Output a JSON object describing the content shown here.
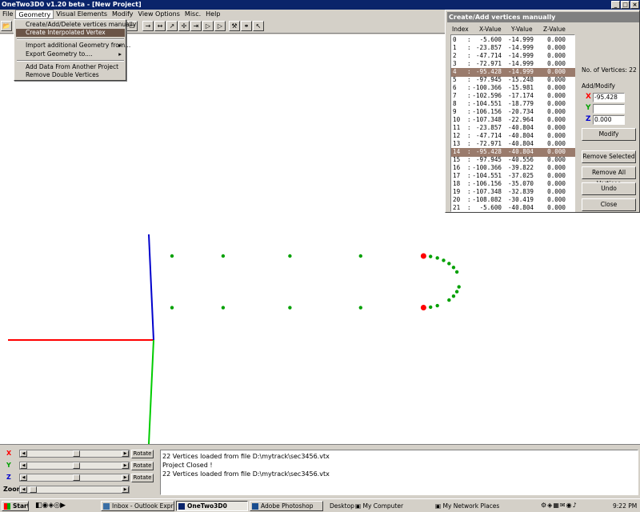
{
  "window": {
    "title": "OneTwo3D0 v1.20 beta - [New Project]",
    "controls": [
      "_",
      "□",
      "×"
    ]
  },
  "menubar": [
    "File",
    "Geometry",
    "Visual Elements",
    "Modify",
    "View Options",
    "Misc.",
    "Help"
  ],
  "geometry_menu": {
    "items": [
      {
        "label": "Create/Add/Delete vertices manually",
        "submenu": false
      },
      {
        "label": "Create Interpolated Vertex",
        "submenu": false,
        "highlighted": true
      },
      {
        "label": "Import additional Geometry from...",
        "submenu": true
      },
      {
        "label": "Export Geometry to....",
        "submenu": true
      },
      {
        "label": "Add Data From Another Project",
        "submenu": false
      },
      {
        "label": "Remove Double Vertices",
        "submenu": false
      }
    ]
  },
  "toolbar": {
    "icons": [
      "open-icon",
      "arrow-right-icon",
      "arrows-horizontal-icon",
      "arrow-diagonal-icon",
      "crosshair-icon",
      "arrow-right-line-icon",
      "arrow-right-bar-icon",
      "arrow-right-bar2-icon",
      "tools-icon",
      "binoculars-icon",
      "cursor-icon"
    ]
  },
  "dialog": {
    "title": "Create/Add vertices manually",
    "columns": [
      "Index",
      "X-Value",
      "Y-Value",
      "Z-Value"
    ],
    "vertices": [
      {
        "i": "0",
        "x": "-5.600",
        "y": "-14.999",
        "z": "0.000"
      },
      {
        "i": "1",
        "x": "-23.857",
        "y": "-14.999",
        "z": "0.000"
      },
      {
        "i": "2",
        "x": "-47.714",
        "y": "-14.999",
        "z": "0.000"
      },
      {
        "i": "3",
        "x": "-72.971",
        "y": "-14.999",
        "z": "0.000"
      },
      {
        "i": "4",
        "x": "-95.428",
        "y": "-14.999",
        "z": "0.000",
        "selected": true
      },
      {
        "i": "5",
        "x": "-97.945",
        "y": "-15.248",
        "z": "0.000"
      },
      {
        "i": "6",
        "x": "-100.366",
        "y": "-15.981",
        "z": "0.000"
      },
      {
        "i": "7",
        "x": "-102.596",
        "y": "-17.174",
        "z": "0.000"
      },
      {
        "i": "8",
        "x": "-104.551",
        "y": "-18.779",
        "z": "0.000"
      },
      {
        "i": "9",
        "x": "-106.156",
        "y": "-20.734",
        "z": "0.000"
      },
      {
        "i": "10",
        "x": "-107.348",
        "y": "-22.964",
        "z": "0.000"
      },
      {
        "i": "11",
        "x": "-23.857",
        "y": "-40.804",
        "z": "0.000"
      },
      {
        "i": "12",
        "x": "-47.714",
        "y": "-40.804",
        "z": "0.000"
      },
      {
        "i": "13",
        "x": "-72.971",
        "y": "-40.804",
        "z": "0.000"
      },
      {
        "i": "14",
        "x": "-95.428",
        "y": "-40.804",
        "z": "0.000",
        "selected": true
      },
      {
        "i": "15",
        "x": "-97.945",
        "y": "-40.556",
        "z": "0.000"
      },
      {
        "i": "16",
        "x": "-100.366",
        "y": "-39.822",
        "z": "0.000"
      },
      {
        "i": "17",
        "x": "-104.551",
        "y": "-37.025",
        "z": "0.000"
      },
      {
        "i": "18",
        "x": "-106.156",
        "y": "-35.070",
        "z": "0.000"
      },
      {
        "i": "19",
        "x": "-107.348",
        "y": "-32.839",
        "z": "0.000"
      },
      {
        "i": "20",
        "x": "-108.082",
        "y": "-30.419",
        "z": "0.000"
      },
      {
        "i": "21",
        "x": "-5.600",
        "y": "-40.804",
        "z": "0.000"
      }
    ],
    "count_label": "No. of Vertices: 22",
    "group_label": "Add/Modify",
    "x_label": "X",
    "y_label": "Y",
    "z_label": "Z",
    "x_value": "-95.428",
    "y_value": "",
    "z_value": "0.000",
    "buttons": {
      "modify": "Modify",
      "remove_selected": "Remove Selected",
      "remove_all": "Remove All Vertices",
      "undo": "Undo",
      "close": "Close"
    }
  },
  "axes_colors": {
    "x": "#ff0000",
    "y": "#0000cc",
    "z": "#00cc00",
    "point": "#00a000",
    "selected_point": "#ff0000"
  },
  "sliders": {
    "x": "X",
    "y": "Y",
    "z": "Z",
    "zoom": "Zoom",
    "rotate": "Rotate"
  },
  "log": [
    "22 Vertices loaded from file D:\\mytrack\\sec3456.vtx",
    "Project Closed !",
    "22 Vertices loaded from file D:\\mytrack\\sec3456.vtx"
  ],
  "taskbar": {
    "start": "Start",
    "tasks": [
      {
        "label": "Inbox - Outlook Express"
      },
      {
        "label": "OneTwo3D0",
        "active": true
      },
      {
        "label": "Adobe Photoshop"
      }
    ],
    "desktop": "Desktop",
    "my_computer": "My Computer",
    "network": "My Network Places",
    "clock": "9:22 PM"
  }
}
